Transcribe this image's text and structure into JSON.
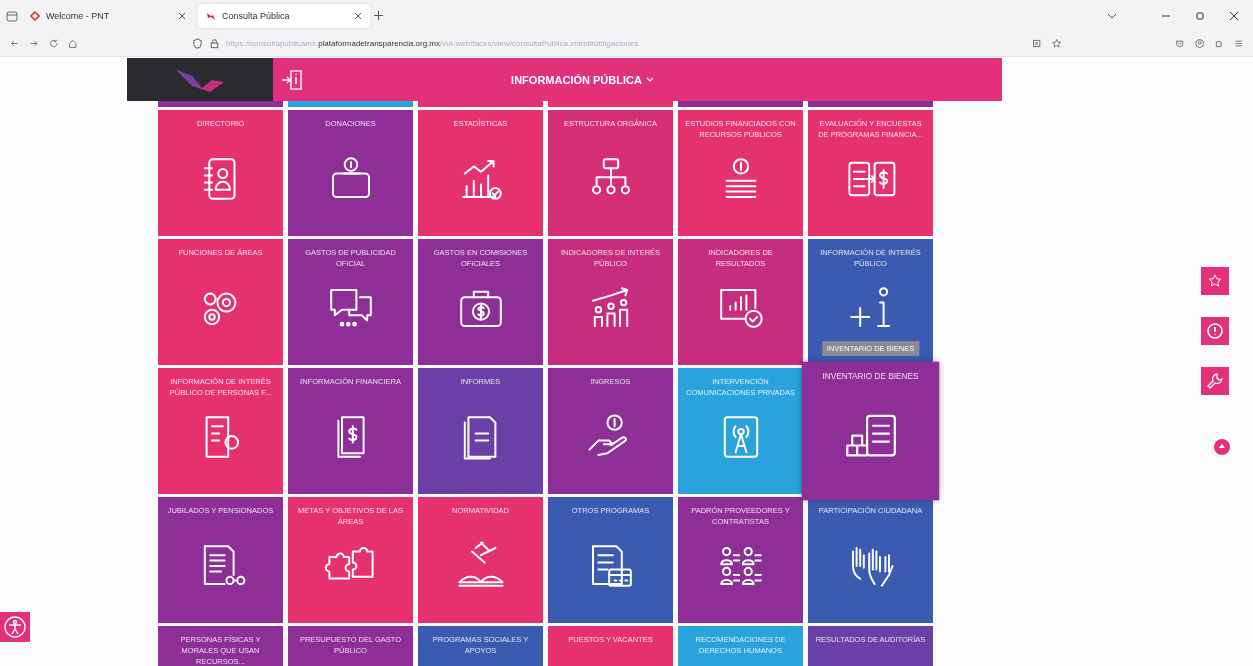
{
  "browser": {
    "tabs": [
      {
        "title": "Welcome - PNT",
        "selected": false
      },
      {
        "title": "Consulta Pública",
        "selected": true
      }
    ],
    "url": "https://consultapublicamx.**plataformadetransparencia.org.mx**/vut-web/faces/view/consultaPublica.xhtml#obligaciones"
  },
  "header": {
    "title": "INFORMACIÓN PÚBLICA"
  },
  "top_strips": [
    {
      "color": "#8e2f97"
    },
    {
      "color": "#2aa3dc"
    },
    {
      "color": "#e5326f"
    },
    {
      "color": "#e5326f"
    },
    {
      "color": "#8e2f97"
    },
    {
      "color": "#8e2f97"
    }
  ],
  "tiles": [
    {
      "label": "DIRECTORIO",
      "color": "#e5326f",
      "hovered": false
    },
    {
      "label": "DONACIONES",
      "color": "#8e2f97",
      "hovered": false
    },
    {
      "label": "ESTADÍSTICAS",
      "color": "#e5326f",
      "hovered": false
    },
    {
      "label": "ESTRUCTURA ORGÁNICA",
      "color": "#d62e74",
      "hovered": false
    },
    {
      "label": "ESTUDIOS FINANCIADOS CON RECURSOS PÚBLICOS",
      "color": "#e5326f",
      "hovered": false
    },
    {
      "label": "EVALUACIÓN Y ENCUESTAS DE PROGRAMAS FINANCIA...",
      "color": "#e5326f",
      "hovered": false
    },
    {
      "label": "FUNCIONES DE ÁREAS",
      "color": "#e5326f",
      "hovered": false
    },
    {
      "label": "GASTOS DE PUBLICIDAD OFICIAL",
      "color": "#8e2f97",
      "hovered": false
    },
    {
      "label": "GASTOS EN COMISIONES OFICIALES",
      "color": "#8e2f97",
      "hovered": false
    },
    {
      "label": "INDICADORES DE INTERÉS PÚBLICO",
      "color": "#c72d7e",
      "hovered": false
    },
    {
      "label": "INDICADORES DE RESULTADOS",
      "color": "#c72d7e",
      "hovered": false
    },
    {
      "label": "INFORMACIÓN DE INTERÉS PÚBLICO",
      "color": "#3b5bb1",
      "hovered": false
    },
    {
      "label": "INFORMACIÓN DE INTERÉS PÚBLICO DE PERSONAS F...",
      "color": "#e5326f",
      "hovered": false
    },
    {
      "label": "INFORMACIÓN FINANCIERA",
      "color": "#8e2f97",
      "hovered": false
    },
    {
      "label": "INFORMES",
      "color": "#6a3fa6",
      "hovered": false
    },
    {
      "label": "INGRESOS",
      "color": "#8e2f97",
      "hovered": false
    },
    {
      "label": "INTERVENCIÓN COMUNICACIONES PRIVADAS",
      "color": "#2aa3dc",
      "hovered": false
    },
    {
      "label": "INVENTARIO DE BIENES",
      "color": "#8e2f97",
      "hovered": true,
      "tooltip": "INVENTARIO DE BIENES"
    },
    {
      "label": "JUBILADOS Y PENSIONADOS",
      "color": "#8e2f97",
      "hovered": false
    },
    {
      "label": "METAS Y OBJETIVOS DE LAS ÁREAS",
      "color": "#e5326f",
      "hovered": false
    },
    {
      "label": "NORMATIVIDAD",
      "color": "#e5326f",
      "hovered": false
    },
    {
      "label": "OTROS PROGRAMAS",
      "color": "#3b5bb1",
      "hovered": false
    },
    {
      "label": "PADRÓN PROVEEDORES Y CONTRATISTAS",
      "color": "#8e2f97",
      "hovered": false
    },
    {
      "label": "PARTICIPACIÓN CIUDADANA",
      "color": "#3b5bb1",
      "hovered": false
    },
    {
      "label": "PERSONAS FÍSICAS Y MORALES QUE USAN RECURSOS...",
      "color": "#8e2f97",
      "hovered": false
    },
    {
      "label": "PRESUPUESTO DEL GASTO PÚBLICO",
      "color": "#8e2f97",
      "hovered": false
    },
    {
      "label": "PROGRAMAS SOCIALES Y APOYOS",
      "color": "#3b5bb1",
      "hovered": false
    },
    {
      "label": "PUESTOS Y VACANTES",
      "color": "#e5326f",
      "hovered": false
    },
    {
      "label": "RECOMENDACIONES DE DERECHOS HUMANOS",
      "color": "#2aa3dc",
      "hovered": false
    },
    {
      "label": "RESULTADOS DE AUDITORÍAS",
      "color": "#6a3fa6",
      "hovered": false
    }
  ]
}
